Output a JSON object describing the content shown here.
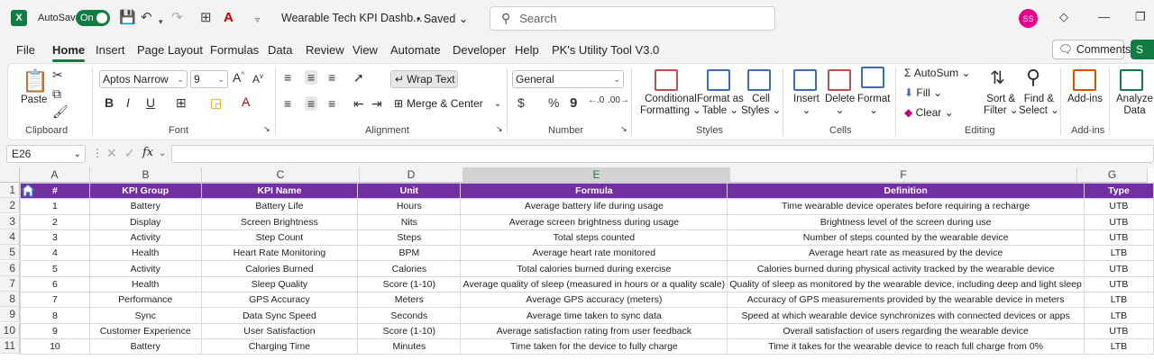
{
  "titlebar": {
    "autosave_label": "AutoSave",
    "autosave_state": "On",
    "doc_title": "Wearable Tech KPI Dashb...",
    "saved_status": "• Saved",
    "search_placeholder": "Search",
    "user_initials": "SS"
  },
  "menu": {
    "items": [
      "File",
      "Home",
      "Insert",
      "Page Layout",
      "Formulas",
      "Data",
      "Review",
      "View",
      "Automate",
      "Developer",
      "Help",
      "PK's Utility Tool V3.0"
    ],
    "active": "Home",
    "comments_label": "Comments",
    "share_label": "S"
  },
  "ribbon": {
    "clipboard": {
      "paste": "Paste",
      "group": "Clipboard"
    },
    "font": {
      "family": "Aptos Narrow",
      "size": "9",
      "group": "Font"
    },
    "alignment": {
      "wrap_text": "Wrap Text",
      "merge_center": "Merge & Center",
      "group": "Alignment"
    },
    "number": {
      "format": "General",
      "group": "Number"
    },
    "styles": {
      "conditional": "Conditional",
      "formatting": "Formatting",
      "format_as": "Format as",
      "table": "Table",
      "cell": "Cell",
      "styles_label": "Styles",
      "group": "Styles"
    },
    "cells": {
      "insert": "Insert",
      "delete": "Delete",
      "format": "Format",
      "group": "Cells"
    },
    "editing": {
      "autosum": "AutoSum",
      "fill": "Fill",
      "clear": "Clear",
      "sort": "Sort &",
      "filter": "Filter",
      "find": "Find &",
      "select": "Select",
      "group": "Editing"
    },
    "addins": {
      "label": "Add-ins",
      "group": "Add-ins"
    },
    "analyze": {
      "line1": "Analyze",
      "line2": "Data"
    }
  },
  "formula_bar": {
    "name_box": "E26",
    "fx": "fx"
  },
  "columns": [
    "A",
    "B",
    "C",
    "D",
    "E",
    "F",
    "G"
  ],
  "selected_column": "E",
  "rows": [
    "1",
    "2",
    "3",
    "4",
    "5",
    "6",
    "7",
    "8",
    "9",
    "10",
    "11"
  ],
  "colors": {
    "header_bg": "#7030a0",
    "excel_green": "#107c41"
  },
  "table": {
    "headers": [
      "#",
      "KPI Group",
      "KPI Name",
      "Unit",
      "Formula",
      "Definition",
      "Type"
    ],
    "rows": [
      [
        "1",
        "Battery",
        "Battery Life",
        "Hours",
        "Average battery life during usage",
        "Time wearable device operates before requiring a recharge",
        "UTB"
      ],
      [
        "2",
        "Display",
        "Screen Brightness",
        "Nits",
        "Average screen brightness during usage",
        "Brightness level of the screen during use",
        "UTB"
      ],
      [
        "3",
        "Activity",
        "Step Count",
        "Steps",
        "Total steps counted",
        "Number of steps counted by the wearable device",
        "UTB"
      ],
      [
        "4",
        "Health",
        "Heart Rate Monitoring",
        "BPM",
        "Average heart rate monitored",
        "Average heart rate as measured by the device",
        "LTB"
      ],
      [
        "5",
        "Activity",
        "Calories Burned",
        "Calories",
        "Total calories burned during exercise",
        "Calories burned during physical activity tracked by the wearable device",
        "UTB"
      ],
      [
        "6",
        "Health",
        "Sleep Quality",
        "Score (1-10)",
        "Average quality of sleep (measured in hours or a quality scale)",
        "Quality of sleep as monitored by the wearable device, including deep and light sleep",
        "UTB"
      ],
      [
        "7",
        "Performance",
        "GPS Accuracy",
        "Meters",
        "Average GPS accuracy (meters)",
        "Accuracy of GPS measurements provided by the wearable device in meters",
        "LTB"
      ],
      [
        "8",
        "Sync",
        "Data Sync Speed",
        "Seconds",
        "Average time taken to sync data",
        "Speed at which wearable device synchronizes with connected devices or apps",
        "LTB"
      ],
      [
        "9",
        "Customer Experience",
        "User Satisfaction",
        "Score (1-10)",
        "Average satisfaction rating from user feedback",
        "Overall satisfaction of users regarding the wearable device",
        "UTB"
      ],
      [
        "10",
        "Battery",
        "Charging Time",
        "Minutes",
        "Time taken for the device to fully charge",
        "Time it takes for the wearable device to reach full charge from 0%",
        "LTB"
      ]
    ]
  }
}
